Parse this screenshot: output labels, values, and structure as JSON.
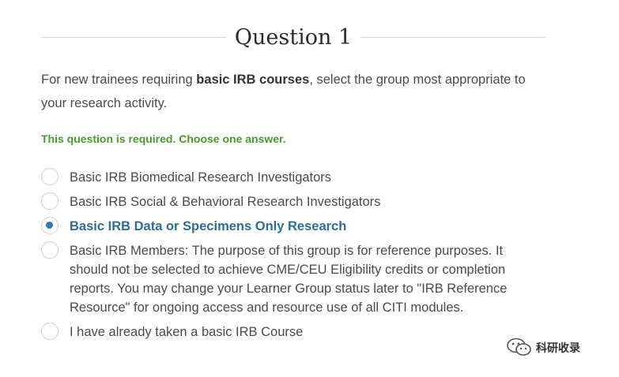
{
  "question": {
    "title": "Question 1",
    "prompt_before": "For new trainees requiring ",
    "prompt_bold": "basic IRB courses",
    "prompt_after": ", select the group most appropriate to your research activity.",
    "required_text": "This question is required. Choose one answer."
  },
  "options": [
    {
      "label": "Basic IRB Biomedical Research Investigators",
      "selected": false
    },
    {
      "label": "Basic IRB Social & Behavioral Research Investigators",
      "selected": false
    },
    {
      "label": "Basic IRB Data or Specimens Only Research",
      "selected": true
    },
    {
      "label": "Basic IRB Members: The purpose of this group is for reference purposes. It should not be selected to achieve CME/CEU Eligibility credits or completion reports. You may change your Learner Group status later to \"IRB Reference Resource\" for ongoing access and resource use of all CITI modules.",
      "selected": false
    },
    {
      "label": "I have already taken a basic IRB Course",
      "selected": false
    }
  ],
  "watermark": {
    "text": "科研收录",
    "icon": "wechat-icon"
  },
  "colors": {
    "required_green": "#4a9a2a",
    "selected_blue": "#2d6e96",
    "radio_dot": "#2d7aab"
  }
}
